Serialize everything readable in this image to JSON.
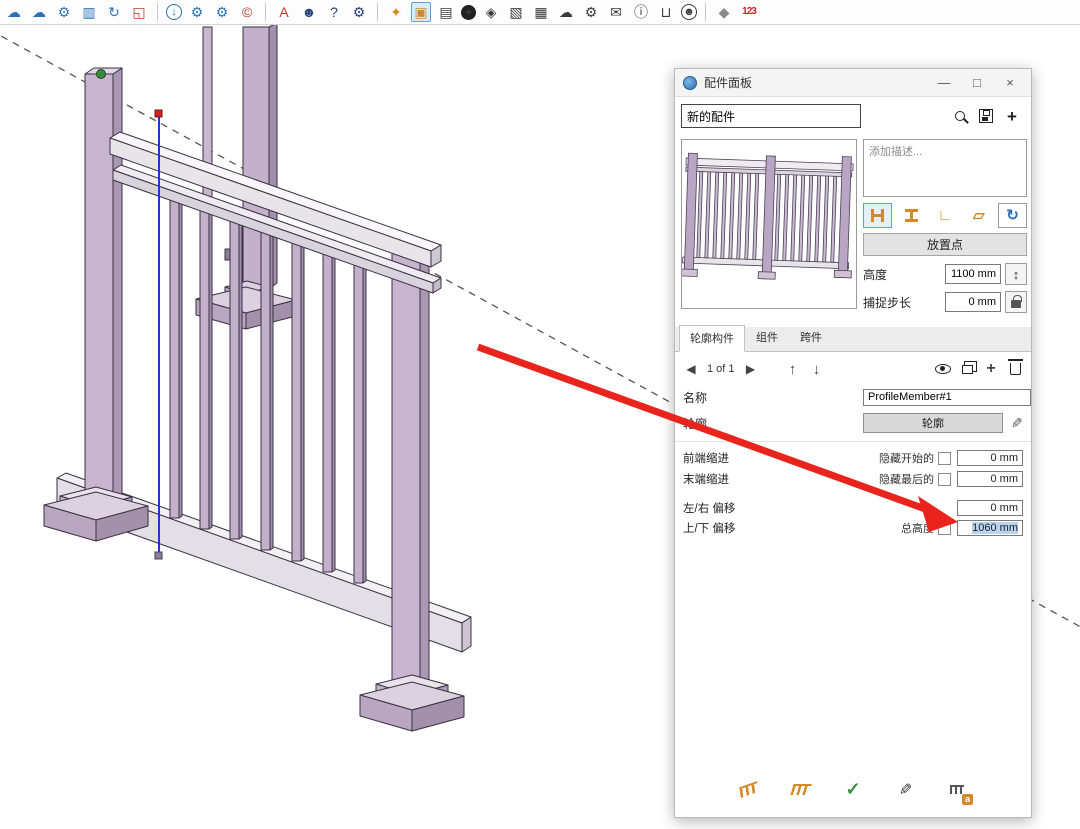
{
  "toolbar": {
    "icons": [
      {
        "name": "cloud-back",
        "glyph": "☁",
        "color": "blue"
      },
      {
        "name": "cloud-forward",
        "glyph": "☁",
        "color": "blue"
      },
      {
        "name": "extension-gears",
        "glyph": "⚙",
        "color": "blue"
      },
      {
        "name": "sliders",
        "glyph": "▥",
        "color": "blue"
      },
      {
        "name": "sync-check",
        "glyph": "↻",
        "color": "blue"
      },
      {
        "name": "red-crop",
        "glyph": "◱",
        "color": "red"
      },
      {
        "name": "download-circle",
        "glyph": "↓",
        "color": "blue",
        "divider_before": true,
        "circled": true
      },
      {
        "name": "gear-settings",
        "glyph": "⚙",
        "color": "blue"
      },
      {
        "name": "gear-pair",
        "glyph": "⚙",
        "color": "blue"
      },
      {
        "name": "compass-logo",
        "glyph": "©",
        "color": "red"
      },
      {
        "name": "text-leader",
        "glyph": "A",
        "color": "red",
        "divider_before": true
      },
      {
        "name": "person",
        "glyph": "☻",
        "color": "darkblue"
      },
      {
        "name": "help",
        "glyph": "?",
        "color": "darkblue"
      },
      {
        "name": "gear-dark",
        "glyph": "⚙",
        "color": "darkblue"
      },
      {
        "name": "material-tool",
        "glyph": "✦",
        "color": "orange",
        "divider_before": true
      },
      {
        "name": "copy-pages",
        "glyph": "▣",
        "color": "orange",
        "selected": true
      },
      {
        "name": "export-box",
        "glyph": "▤",
        "color": "dark"
      },
      {
        "name": "add-circle",
        "glyph": "+",
        "color": "dark",
        "darkcircle": true
      },
      {
        "name": "shield-box",
        "glyph": "◈",
        "color": "dark"
      },
      {
        "name": "doc-ruler",
        "glyph": "▧",
        "color": "dark"
      },
      {
        "name": "checkerboard",
        "glyph": "▦",
        "color": "dark"
      },
      {
        "name": "cloud-upload",
        "glyph": "☁",
        "color": "dark"
      },
      {
        "name": "gear-spark",
        "glyph": "⚙",
        "color": "dark"
      },
      {
        "name": "comment-edit",
        "glyph": "✉",
        "color": "dark"
      },
      {
        "name": "info",
        "glyph": "ⓘ",
        "color": "dark"
      },
      {
        "name": "cart",
        "glyph": "⊔",
        "color": "dark"
      },
      {
        "name": "account-circle",
        "glyph": "☻",
        "color": "dark",
        "circled": true
      },
      {
        "name": "rock-material",
        "glyph": "◆",
        "color": "gray",
        "divider_before": true
      },
      {
        "name": "numbers",
        "glyph": "123",
        "color": "rednum"
      }
    ]
  },
  "panel": {
    "title": "配件面板",
    "window_controls": {
      "minimize": "—",
      "maximize": "□",
      "close": "×"
    },
    "assembly_name_value": "新的配件",
    "add_icon_label": "+",
    "description_placeholder": "添加描述...",
    "profile_buttons": [
      {
        "name": "profile-member-horizontal",
        "type": "ibeam",
        "rot": true,
        "selected": true
      },
      {
        "name": "profile-member-vertical",
        "type": "ibeam",
        "rot": false
      },
      {
        "name": "corner-member",
        "type": "glyph",
        "glyph": "∟"
      },
      {
        "name": "panel-member",
        "type": "glyph",
        "glyph": "▱"
      },
      {
        "name": "rebuild",
        "type": "glyph",
        "glyph": "↻",
        "boxed": true
      }
    ],
    "placement_button": "放置点",
    "height_field": {
      "label": "高度",
      "value": "1100 mm",
      "stepper_glyph": "↕"
    },
    "snap_field": {
      "label": "捕捉步长",
      "value": "0 mm"
    },
    "tabs": [
      {
        "label": "轮廓构件",
        "active": true
      },
      {
        "label": "组件",
        "active": false
      },
      {
        "label": "跨件",
        "active": false
      }
    ],
    "pager": {
      "prev": "◀",
      "text": "1 of 1",
      "next": "▶",
      "up": "↑",
      "down": "↓"
    },
    "member": {
      "name_label": "名称",
      "name_value": "ProfileMember#1",
      "profile_label": "轮廓",
      "profile_button": "轮廓"
    },
    "rows": {
      "front_indent": {
        "label": "前端缩进",
        "check_label": "隐藏开始的",
        "value": "0 mm"
      },
      "end_indent": {
        "label": "末端缩进",
        "check_label": "隐藏最后的",
        "value": "0 mm"
      },
      "lr_offset": {
        "label": "左/右 偏移",
        "value": "0 mm"
      },
      "ud_offset": {
        "label": "上/下 偏移",
        "check_label": "总高度",
        "value": "1060 mm",
        "text_selected": true
      }
    },
    "footer_badge": "a"
  },
  "colors": {
    "accent_blue": "#2a72b8",
    "selected_edge_blue": "#2433dd",
    "annotation_arrow_red": "#e8241c",
    "railing_purple": "#c7b4ce",
    "selection_highlight": "#b8d4f0",
    "endpoint_red": "#cc2222",
    "point_green": "#3a8a3e"
  }
}
